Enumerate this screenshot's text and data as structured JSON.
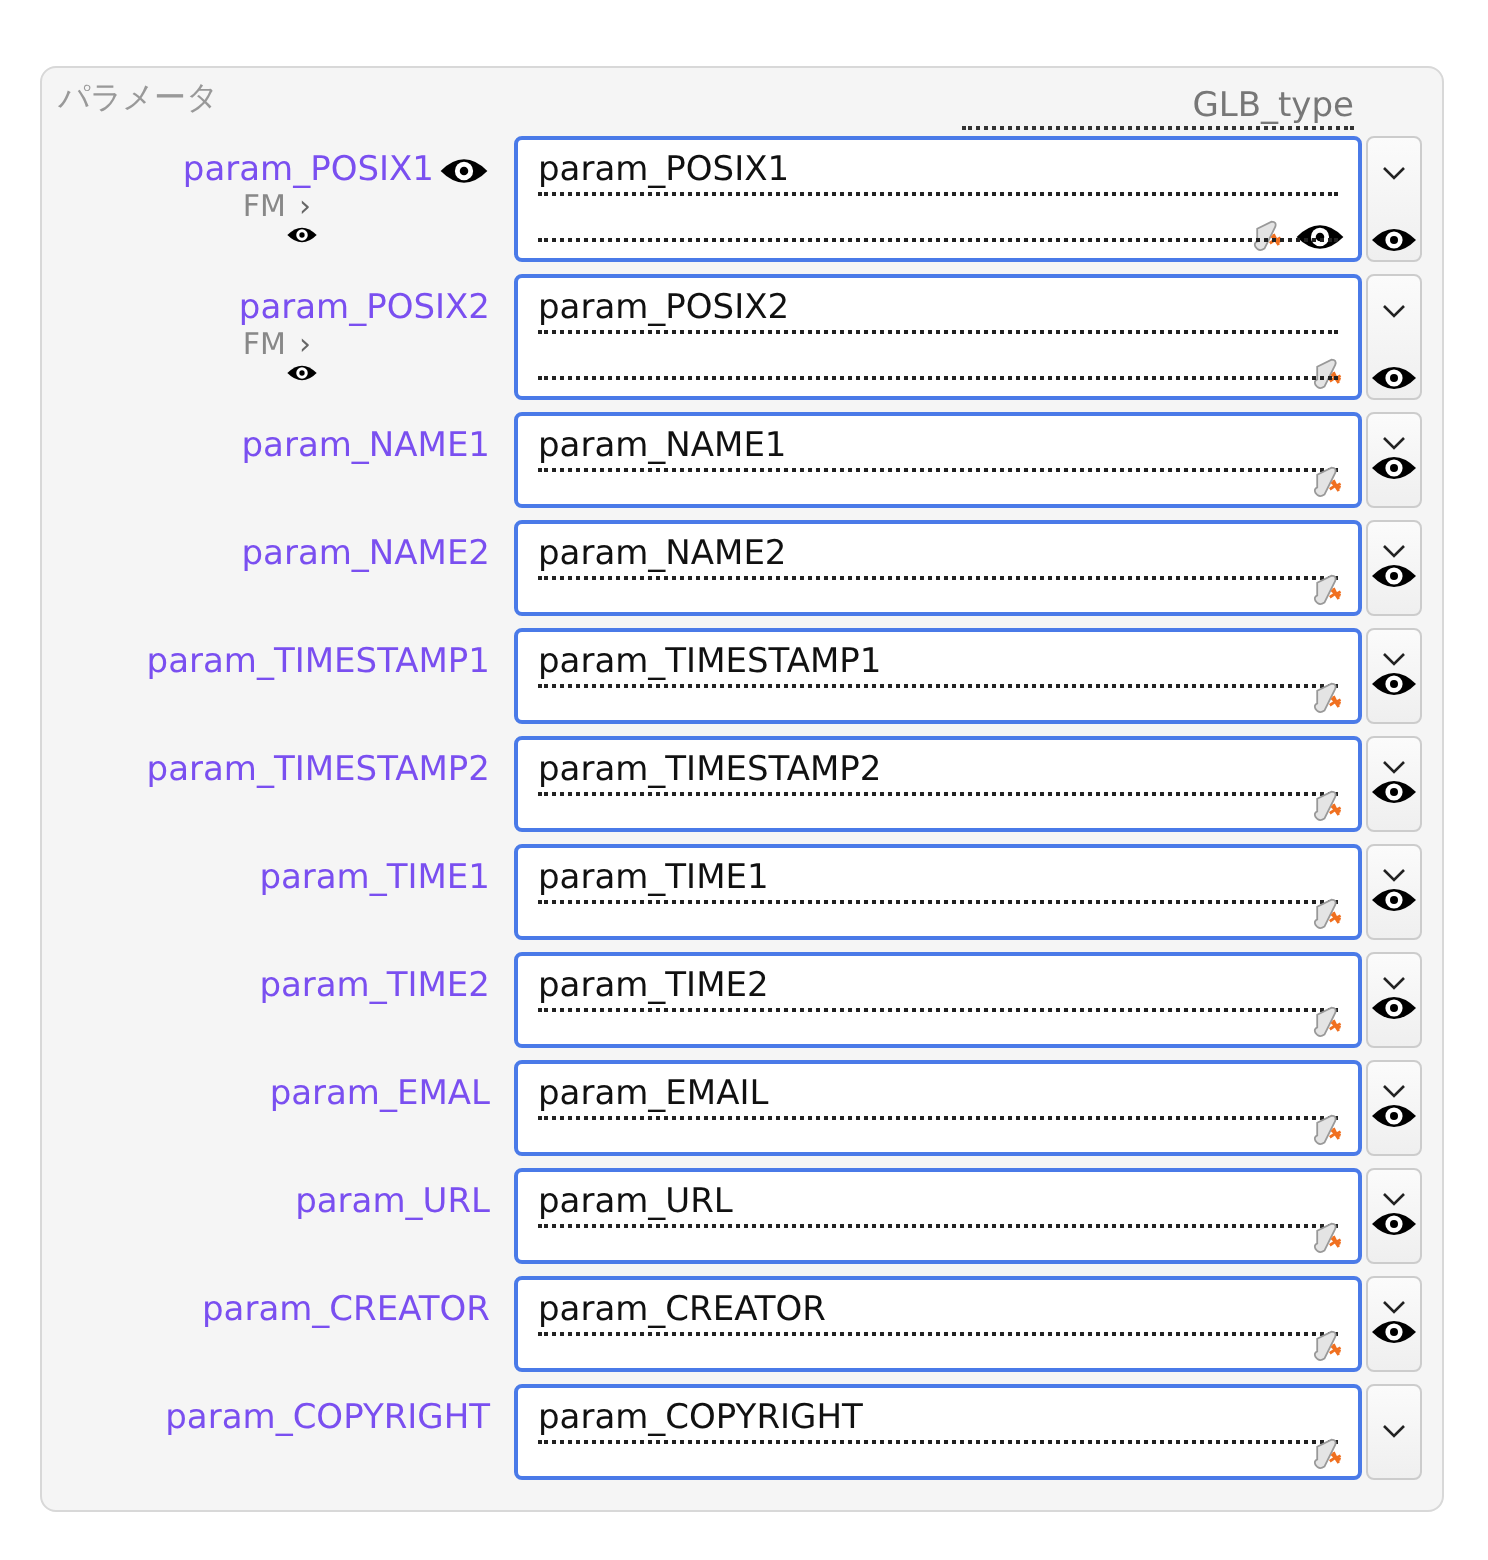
{
  "panel": {
    "legend": "パラメータ",
    "column_header": "GLB_type"
  },
  "rows": [
    {
      "label": "param_POSIX1",
      "label_eye": true,
      "sub": {
        "text": "FM",
        "arrow": "›"
      },
      "value": "param_POSIX1",
      "tall": true,
      "field_eye": true,
      "side_eye": true
    },
    {
      "label": "param_POSIX2",
      "label_eye": false,
      "sub": {
        "text": "FM",
        "arrow": "›"
      },
      "value": "param_POSIX2",
      "tall": true,
      "field_eye": false,
      "side_eye": true
    },
    {
      "label": "param_NAME1",
      "label_eye": false,
      "value": "param_NAME1",
      "tall": false,
      "field_eye": false,
      "side_eye": true
    },
    {
      "label": "param_NAME2",
      "label_eye": false,
      "value": "param_NAME2",
      "tall": false,
      "field_eye": false,
      "side_eye": true
    },
    {
      "label": "param_TIMESTAMP1",
      "label_eye": false,
      "value": "param_TIMESTAMP1",
      "tall": false,
      "field_eye": false,
      "side_eye": true
    },
    {
      "label": "param_TIMESTAMP2",
      "label_eye": false,
      "value": "param_TIMESTAMP2",
      "tall": false,
      "field_eye": false,
      "side_eye": true
    },
    {
      "label": "param_TIME1",
      "label_eye": false,
      "value": "param_TIME1",
      "tall": false,
      "field_eye": false,
      "side_eye": true
    },
    {
      "label": "param_TIME2",
      "label_eye": false,
      "value": "param_TIME2",
      "tall": false,
      "field_eye": false,
      "side_eye": true
    },
    {
      "label": "param_EMAL",
      "label_eye": false,
      "value": "param_EMAIL",
      "tall": false,
      "field_eye": false,
      "side_eye": true
    },
    {
      "label": "param_URL",
      "label_eye": false,
      "value": "param_URL",
      "tall": false,
      "field_eye": false,
      "side_eye": true
    },
    {
      "label": "param_CREATOR",
      "label_eye": false,
      "value": "param_CREATOR",
      "tall": false,
      "field_eye": false,
      "side_eye": true
    },
    {
      "label": "param_COPYRIGHT",
      "label_eye": false,
      "value": "param_COPYRIGHT",
      "tall": false,
      "field_eye": false,
      "side_eye": false
    }
  ]
}
